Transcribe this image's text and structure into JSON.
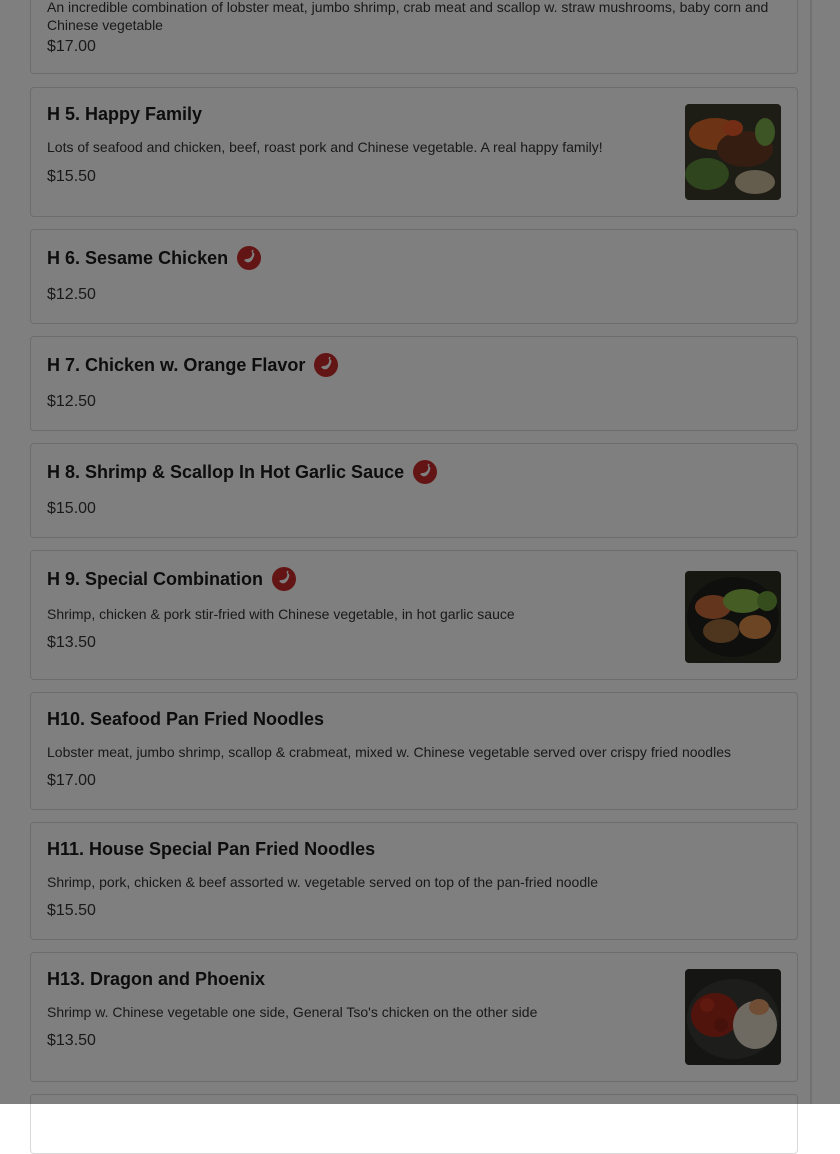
{
  "items": [
    {
      "desc": "An incredible combination of lobster meat, jumbo shrimp, crab meat and scallop w. straw mushrooms, baby corn and Chinese vegetable",
      "price": "$17.00"
    },
    {
      "name": "H 5. Happy Family",
      "desc": "Lots of seafood and chicken, beef, roast pork and Chinese vegetable. A real happy family!",
      "price": "$15.50",
      "has_image": true
    },
    {
      "name": "H 6. Sesame Chicken",
      "price": "$12.50",
      "spicy": true
    },
    {
      "name": "H 7. Chicken w. Orange Flavor",
      "price": "$12.50",
      "spicy": true
    },
    {
      "name": "H 8. Shrimp & Scallop In Hot Garlic Sauce",
      "price": "$15.00",
      "spicy": true
    },
    {
      "name": "H 9. Special Combination",
      "desc": "Shrimp, chicken & pork stir-fried with Chinese vegetable, in hot garlic sauce",
      "price": "$13.50",
      "spicy": true,
      "has_image": true
    },
    {
      "name": "H10. Seafood Pan Fried Noodles",
      "desc": "Lobster meat, jumbo shrimp, scallop & crabmeat, mixed w. Chinese vegetable served over crispy fried noodles",
      "price": "$17.00"
    },
    {
      "name": "H11. House Special Pan Fried Noodles",
      "desc": "Shrimp, pork, chicken & beef assorted w. vegetable served on top of the pan-fried noodle",
      "price": "$15.50"
    },
    {
      "name": "H13. Dragon and Phoenix",
      "desc": "Shrimp w. Chinese vegetable one side, General Tso's chicken on the other side",
      "price": "$13.50",
      "has_image": true
    }
  ],
  "colors": {
    "spicy_badge": "#c62828",
    "card_border": "#d9d9d9",
    "overlay": "rgba(0,0,0,0.5)"
  },
  "icons": {
    "spicy": "chili-pepper-icon"
  }
}
